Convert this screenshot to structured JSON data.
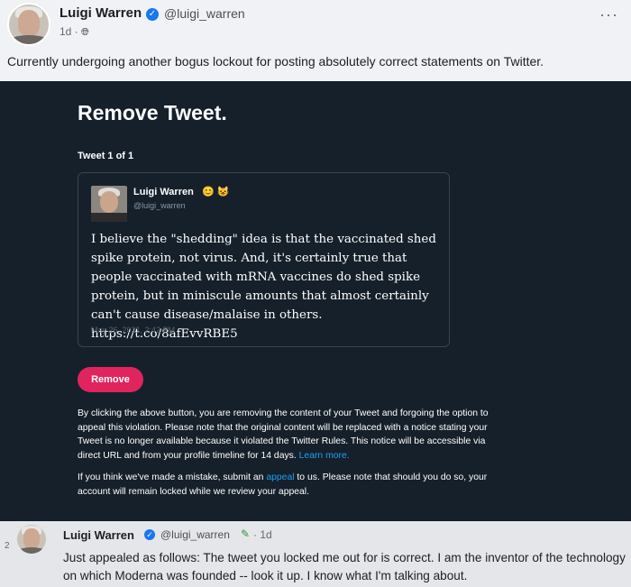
{
  "top_post": {
    "author": "Luigi Warren",
    "handle": "@luigi_warren",
    "time": "1d ·",
    "audience_icon": "globe-icon",
    "more_icon": "···",
    "body": "Currently undergoing another bogus lockout for posting absolutely correct statements on Twitter."
  },
  "twitter_notice": {
    "title": "Remove Tweet.",
    "tweet_count": "Tweet 1 of 1",
    "tweet": {
      "author": "Luigi Warren",
      "emojis": "😊 😺",
      "handle": "@luigi_warren",
      "text": "I believe the \"shedding\" idea is that the vaccinated shed spike protein, not virus. And, it's certainly true that people vaccinated with mRNA vaccines do shed spike protein, but in miniscule amounts that almost certainly can't cause disease/malaise in others. https://t.co/8afEvvRBE5",
      "date": "May 26, 2021, 2:42 PM"
    },
    "remove_label": "Remove",
    "notice_text": "By clicking the above button, you are removing the content of your Tweet and forgoing the option to appeal this violation. Please note that the original content will be replaced with a notice stating your Tweet is no longer available because it violated the Twitter Rules. This notice will be accessible via direct URL and from your profile timeline for 14 days.",
    "learn_more": "Learn more.",
    "appeal_prefix": "If you think we've made a mistake, submit an",
    "appeal_link": "appeal",
    "appeal_suffix": "to us. Please note that should you do so, your account will remain locked while we review your appeal."
  },
  "comment": {
    "reply_count": "2",
    "author": "Luigi Warren",
    "handle": "@luigi_warren",
    "time": "· 1d",
    "body": "Just appealed as follows: The tweet you locked me out for is correct. I am the inventor of the technology on which Moderna was founded -- look it up. I know what I'm talking about."
  },
  "colors": {
    "dark_bg": "#15202b",
    "remove_button": "#e0245e",
    "link_blue": "#1da1f2",
    "facebook_verified": "#1877f2"
  }
}
